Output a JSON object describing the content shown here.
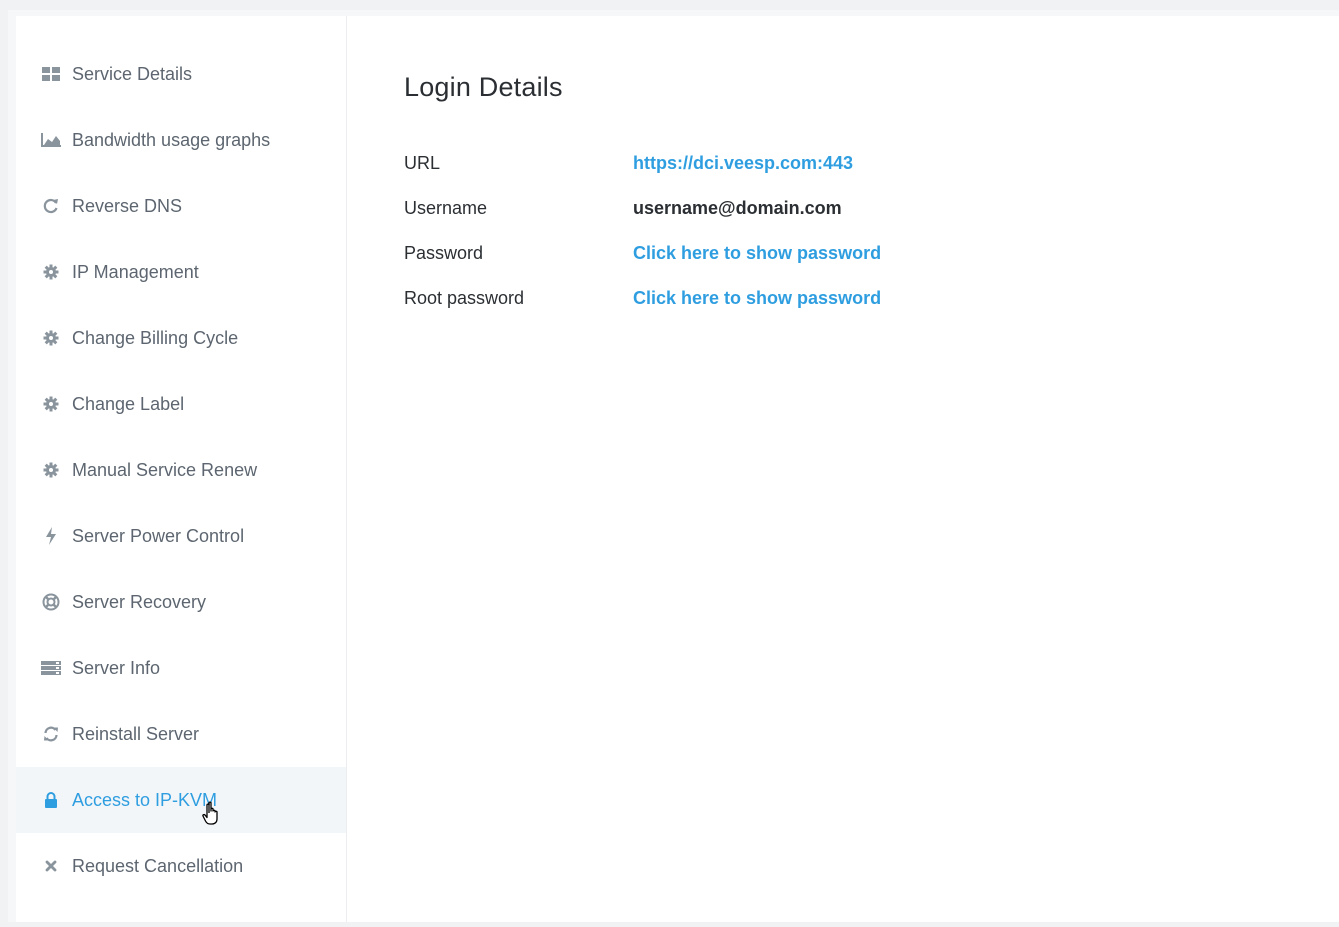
{
  "sidebar": {
    "items": [
      {
        "label": "Service Details",
        "icon": "grid-icon"
      },
      {
        "label": "Bandwidth usage graphs",
        "icon": "area-chart-icon"
      },
      {
        "label": "Reverse DNS",
        "icon": "refresh-icon"
      },
      {
        "label": "IP Management",
        "icon": "gear-icon"
      },
      {
        "label": "Change Billing Cycle",
        "icon": "gear-icon"
      },
      {
        "label": "Change Label",
        "icon": "gear-icon"
      },
      {
        "label": "Manual Service Renew",
        "icon": "gear-icon"
      },
      {
        "label": "Server Power Control",
        "icon": "bolt-icon"
      },
      {
        "label": "Server Recovery",
        "icon": "lifebuoy-icon"
      },
      {
        "label": "Server Info",
        "icon": "server-icon"
      },
      {
        "label": "Reinstall Server",
        "icon": "sync-icon"
      },
      {
        "label": "Access to IP-KVM",
        "icon": "lock-icon",
        "active": true
      },
      {
        "label": "Request Cancellation",
        "icon": "close-icon"
      }
    ]
  },
  "main": {
    "title": "Login Details",
    "fields": [
      {
        "label": "URL",
        "value": "https://dci.veesp.com:443",
        "link": true
      },
      {
        "label": "Username",
        "value": "username@domain.com",
        "link": false
      },
      {
        "label": "Password",
        "value": "Click here to show password",
        "link": true
      },
      {
        "label": "Root password",
        "value": "Click here to show password",
        "link": true
      }
    ]
  },
  "colors": {
    "accent": "#2f9ee0",
    "sidebar_text": "#5d6670",
    "active_bg": "#f3f6f9"
  }
}
